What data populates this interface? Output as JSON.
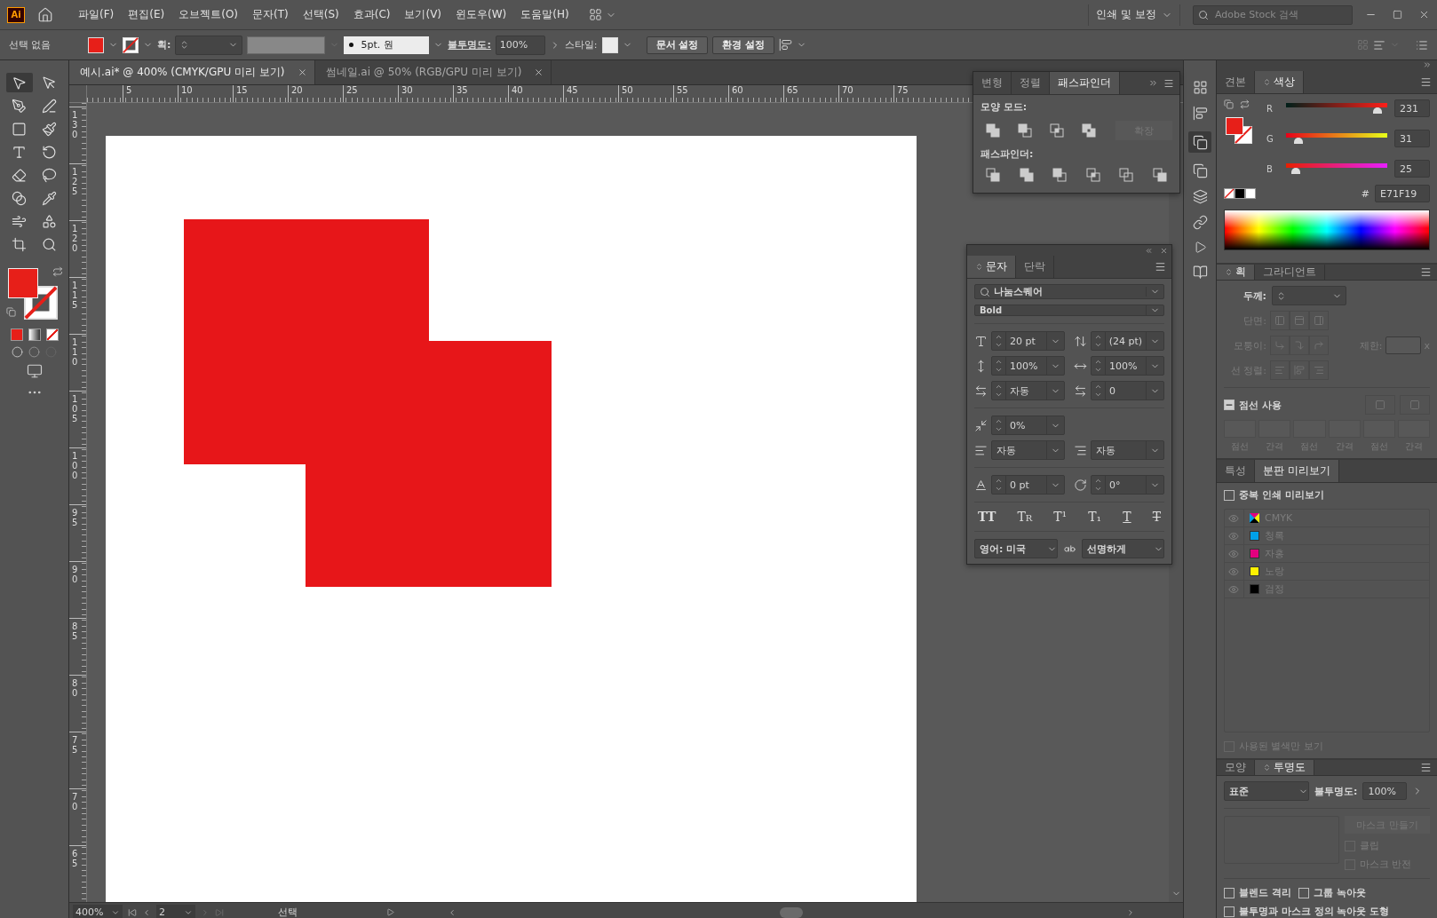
{
  "app": {
    "logo": "Ai",
    "menu": [
      "파일(F)",
      "편집(E)",
      "오브젝트(O)",
      "문자(T)",
      "선택(S)",
      "효과(C)",
      "보기(V)",
      "윈도우(W)",
      "도움말(H)"
    ],
    "workspace": "인쇄 및 보정",
    "search": {
      "placeholder": "Adobe Stock 검색"
    }
  },
  "control_bar": {
    "selection": "선택 없음",
    "stroke_label": "획:",
    "brush": "5pt. 원",
    "opacity_label": "불투명도:",
    "opacity": "100%",
    "style_label": "스타일:",
    "buttons": [
      "문서 설정",
      "환경 설정"
    ]
  },
  "documents": [
    {
      "title": "예시.ai* @ 400% (CMYK/GPU 미리 보기)",
      "selected": true
    },
    {
      "title": "썸네일.ai @ 50% (RGB/GPU 미리 보기)",
      "selected": false
    }
  ],
  "rulers": {
    "horizontal": [
      "5",
      "10",
      "15",
      "20",
      "25",
      "30",
      "35",
      "40",
      "45",
      "50",
      "55",
      "60",
      "65",
      "70",
      "75"
    ],
    "vertical": [
      "130",
      "125",
      "120",
      "115",
      "110",
      "105",
      "100",
      "95",
      "90",
      "85",
      "80",
      "75",
      "70",
      "65"
    ]
  },
  "status_bar": {
    "zoom": "400%",
    "artboard": "2",
    "tool": "선택"
  },
  "pathfinder_panel": {
    "tabs": [
      {
        "label": "변형",
        "selected": false
      },
      {
        "label": "정렬",
        "selected": false
      },
      {
        "label": "패스파인더",
        "selected": true
      }
    ],
    "shape_modes_label": "모양 모드:",
    "expand": "확장",
    "pathfinders_label": "패스파인더:"
  },
  "character_panel": {
    "tabs": [
      {
        "label": "문자",
        "selected": true
      },
      {
        "label": "단락",
        "selected": false
      }
    ],
    "font": "나눔스퀘어",
    "style": "Bold",
    "rows": [
      [
        {
          "kind": "size",
          "value": "20 pt"
        },
        {
          "kind": "leading",
          "value": "(24 pt)"
        }
      ],
      [
        {
          "kind": "vscale",
          "value": "100%"
        },
        {
          "kind": "hscale",
          "value": "100%"
        }
      ],
      [
        {
          "kind": "kerning",
          "value": "자동"
        },
        {
          "kind": "tracking",
          "value": "0"
        }
      ],
      [
        {
          "kind": "tsume",
          "value": "0%"
        }
      ],
      [
        {
          "kind": "aki-left",
          "value": "자동"
        },
        {
          "kind": "aki-right",
          "value": "자동"
        }
      ],
      [
        {
          "kind": "baseline",
          "value": "0 pt"
        },
        {
          "kind": "rotation",
          "value": "0°"
        }
      ]
    ],
    "type_buttons": [
      {
        "label": "TT",
        "kind": "caps"
      },
      {
        "label": "Tr",
        "kind": "small-caps"
      },
      {
        "label": "T¹",
        "kind": "superscript"
      },
      {
        "label": "T₁",
        "kind": "subscript"
      },
      {
        "label": "T",
        "kind": "underline"
      },
      {
        "label": "T",
        "kind": "strikethrough"
      }
    ],
    "language": "영어: 미국",
    "antialias": "선명하게"
  },
  "color_panel": {
    "tabs": [
      {
        "label": "견본",
        "selected": false
      },
      {
        "label": "색상",
        "selected": true
      }
    ],
    "channels": [
      {
        "name": "R",
        "value": "231",
        "level": 0.9
      },
      {
        "name": "G",
        "value": "31",
        "level": 0.12
      },
      {
        "name": "B",
        "value": "25",
        "level": 0.1
      }
    ],
    "hex_label": "#",
    "hex": "E71F19"
  },
  "stroke_panel": {
    "tabs": [
      {
        "label": "획",
        "selected": true
      },
      {
        "label": "그라디언트",
        "selected": false
      }
    ],
    "weight_label": "두께:",
    "cap_label": "단면:",
    "corner_label": "모퉁이:",
    "limit_label": "제한:",
    "limit_unit": "x",
    "align_label": "선 정렬:",
    "dashed": {
      "label": "점선 사용",
      "indeterminate": true
    },
    "dash_labels": [
      "점선",
      "간격",
      "점선",
      "간격",
      "점선",
      "간격"
    ]
  },
  "separations_panel": {
    "tabs": [
      {
        "label": "특성",
        "selected": false
      },
      {
        "label": "분판 미리보기",
        "selected": true
      }
    ],
    "overprint": {
      "label": "중복 인쇄 미리보기",
      "checked": false
    },
    "separations": [
      {
        "name": "CMYK",
        "kind": "composite"
      },
      {
        "name": "청록",
        "kind": "ink",
        "color": "#00a0e9"
      },
      {
        "name": "자홍",
        "kind": "ink",
        "color": "#e4007f"
      },
      {
        "name": "노랑",
        "kind": "ink",
        "color": "#fff100"
      },
      {
        "name": "검정",
        "kind": "ink",
        "color": "#000000"
      }
    ],
    "used_only": {
      "label": "사용된 별색만 보기",
      "checked": false
    }
  },
  "transparency_panel": {
    "tabs": [
      {
        "label": "모양",
        "selected": false
      },
      {
        "label": "투명도",
        "selected": true
      }
    ],
    "blend_mode": "표준",
    "opacity_label": "불투명도:",
    "opacity": "100%",
    "make_mask": "마스크 만들기",
    "clip": {
      "label": "클립",
      "checked": false
    },
    "invert": {
      "label": "마스크 반전",
      "checked": false
    },
    "options": [
      {
        "label": "블렌드 격리",
        "checked": false
      },
      {
        "label": "그룹 녹아웃",
        "checked": false
      },
      {
        "label": "불투명과 마스크 정의 녹아웃 도형",
        "checked": false
      }
    ]
  }
}
